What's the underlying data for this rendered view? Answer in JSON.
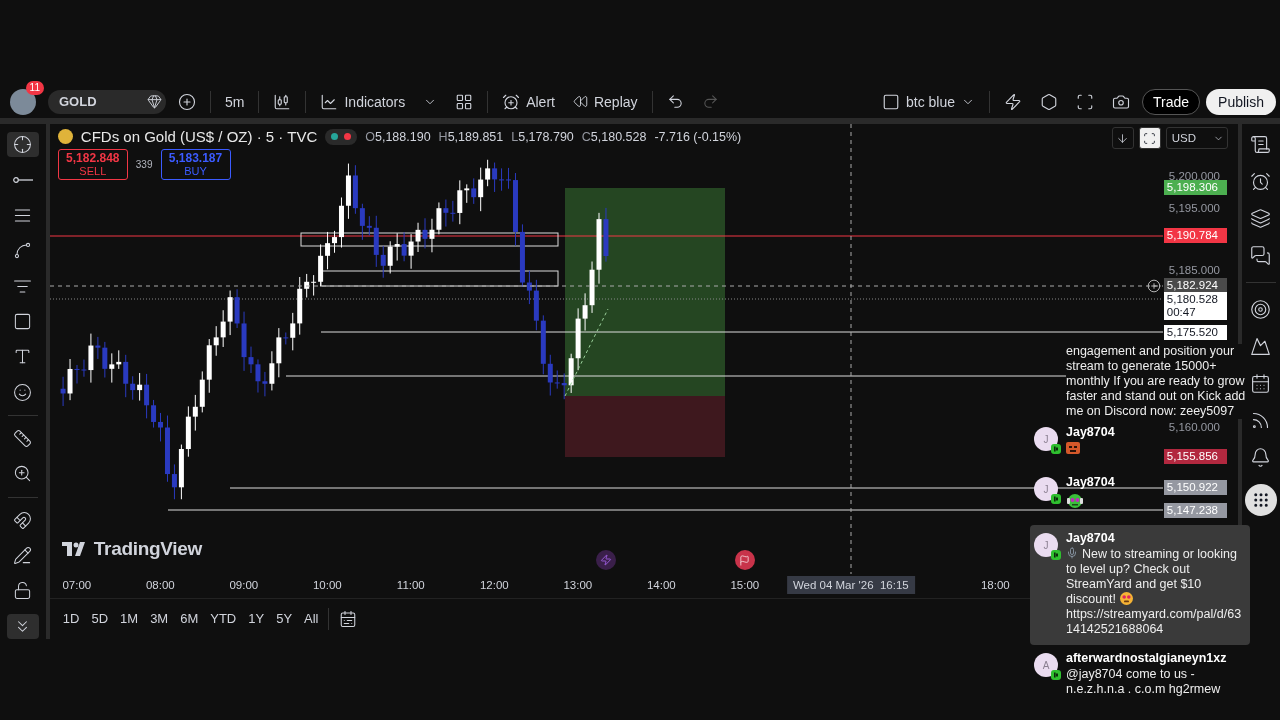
{
  "toolbar": {
    "notification_count": "11",
    "symbol": "GOLD",
    "interval": "5m",
    "indicators": "Indicators",
    "alert": "Alert",
    "replay": "Replay",
    "layout_name": "btc blue",
    "trade": "Trade",
    "publish": "Publish"
  },
  "legend": {
    "title": "CFDs on Gold (US$ / OZ) · 5 · TVC",
    "ohlc": [
      {
        "key": "O",
        "value": "5,188.190"
      },
      {
        "key": "H",
        "value": "5,189.851"
      },
      {
        "key": "L",
        "value": "5,178.790"
      },
      {
        "key": "C",
        "value": "5,180.528"
      }
    ],
    "change": "-7.716 (-0.15%)"
  },
  "order_buttons": [
    {
      "kind": "sell",
      "price": "5,182.848",
      "label": "SELL"
    },
    {
      "kind": "buy",
      "price": "5,183.187",
      "label": "BUY"
    }
  ],
  "spread": "339",
  "price_axis": {
    "currency": "USD",
    "ticks": [
      "5,200.000",
      "5,195.000",
      "5,185.000",
      "5,160.000"
    ],
    "tags": [
      {
        "price": "5,198.306",
        "color": "#4caf50"
      },
      {
        "price": "5,190.784",
        "color": "#f23645"
      },
      {
        "price": "5,182.924",
        "color": "#4a4a4a"
      },
      {
        "price": "5,180.528",
        "color": "#ffffff",
        "countdown": "00:47"
      },
      {
        "price": "5,175.520",
        "color": "#ffffff"
      },
      {
        "price": "5,155.856",
        "color": "#b2283f"
      },
      {
        "price": "5,150.922",
        "color": "#9598a1"
      },
      {
        "price": "5,147.238",
        "color": "#9598a1"
      }
    ]
  },
  "brand": "TradingView",
  "time_axis": {
    "ticks": [
      "07:00",
      "08:00",
      "09:00",
      "10:00",
      "11:00",
      "12:00",
      "13:00",
      "14:00",
      "15:00",
      "18:00"
    ],
    "crosshair_label": "Wed 04 Mar '26  16:15"
  },
  "periods": [
    "1D",
    "5D",
    "1M",
    "3M",
    "6M",
    "YTD",
    "1Y",
    "5Y",
    "All"
  ],
  "chat": [
    {
      "kind": "text",
      "text": "engagement and position your stream to generate 15000+ monthly If you are ready to grow faster and stand out on Kick add me on Discord now: zeey5097"
    },
    {
      "kind": "emote",
      "user": "Jay8704",
      "initial": "J"
    },
    {
      "kind": "emote",
      "user": "Jay8704",
      "initial": "J"
    },
    {
      "kind": "promo",
      "user": "Jay8704",
      "initial": "J",
      "highlighted": true,
      "text": "New to streaming or looking to level up? Check out StreamYard and get $10 discount!",
      "link": "https://streamyard.com/pal/d/6314142521688064"
    },
    {
      "kind": "message",
      "user": "afterwardnostalgianeyn1xz",
      "initial": "A",
      "highlighted": false,
      "text": "@jay8704 come to us - n.e.z.h.n.a . c.o.m hg2rmew"
    }
  ]
}
